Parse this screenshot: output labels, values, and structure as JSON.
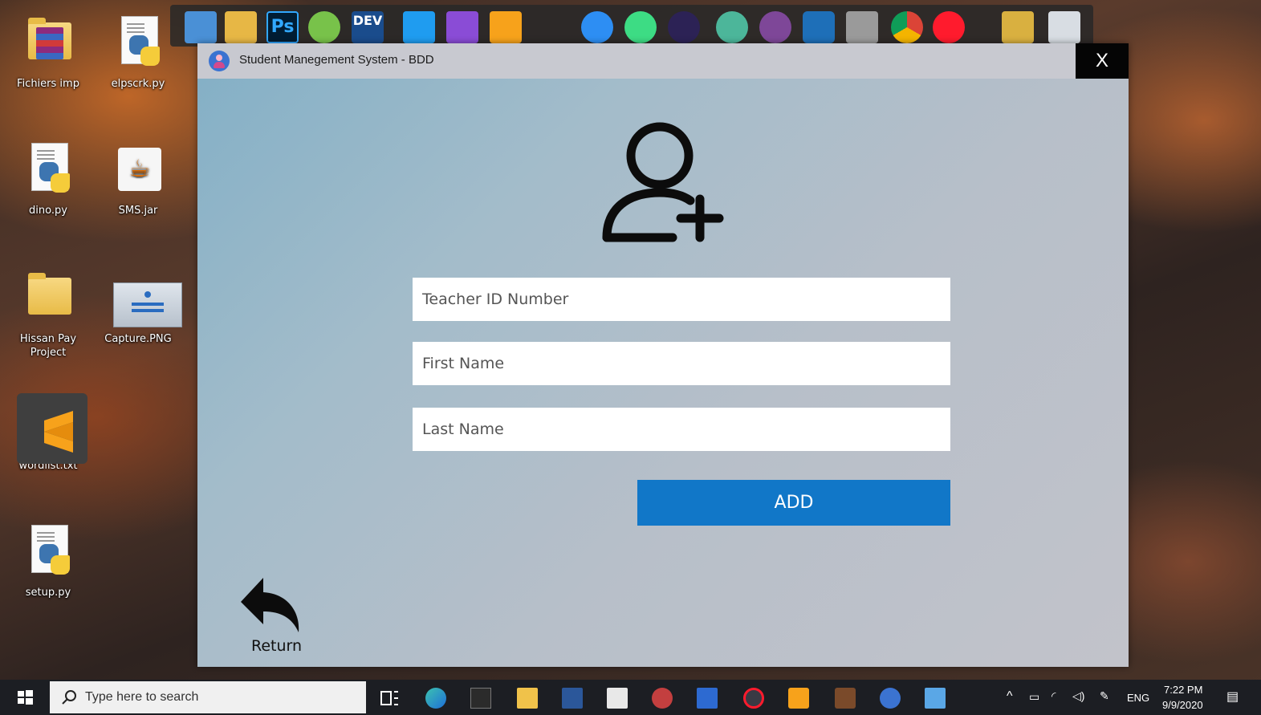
{
  "desktop": {
    "icons": [
      {
        "label": "Fichiers imp"
      },
      {
        "label": "elpscrk.py"
      },
      {
        "label": "dino.py"
      },
      {
        "label": "SMS.jar"
      },
      {
        "label": "Hissan Pay Project"
      },
      {
        "label": "Capture.PNG"
      },
      {
        "label": "wordlist.txt"
      },
      {
        "label": "setup.py"
      }
    ]
  },
  "dock": {
    "icons": [
      "file-explorer-icon",
      "photoshop-icon",
      "utorrent-icon",
      "dev-cpp-icon",
      "vscode-icon",
      "visual-studio-icon",
      "sublime-icon",
      "messenger-icon",
      "android-studio-icon",
      "eclipse-icon",
      "atom-icon",
      "tor-icon",
      "virtualbox-icon",
      "tools-icon",
      "chrome-icon",
      "opera-icon",
      "pickaxe-icon",
      "recycle-bin-icon"
    ],
    "ps_label": "Ps",
    "dev_label": "DEV"
  },
  "window": {
    "title": "Student Manegement System - BDD",
    "close_label": "X"
  },
  "form": {
    "teacher_id_placeholder": "Teacher ID Number",
    "first_name_placeholder": "First Name",
    "last_name_placeholder": "Last Name",
    "add_label": "ADD",
    "return_label": "Return"
  },
  "taskbar": {
    "search_placeholder": "Type here to search",
    "language": "ENG",
    "time": "7:22 PM",
    "date": "9/9/2020"
  },
  "colors": {
    "add_button": "#1177c8",
    "close_button": "#050505",
    "taskbar": "#1c1e23"
  }
}
